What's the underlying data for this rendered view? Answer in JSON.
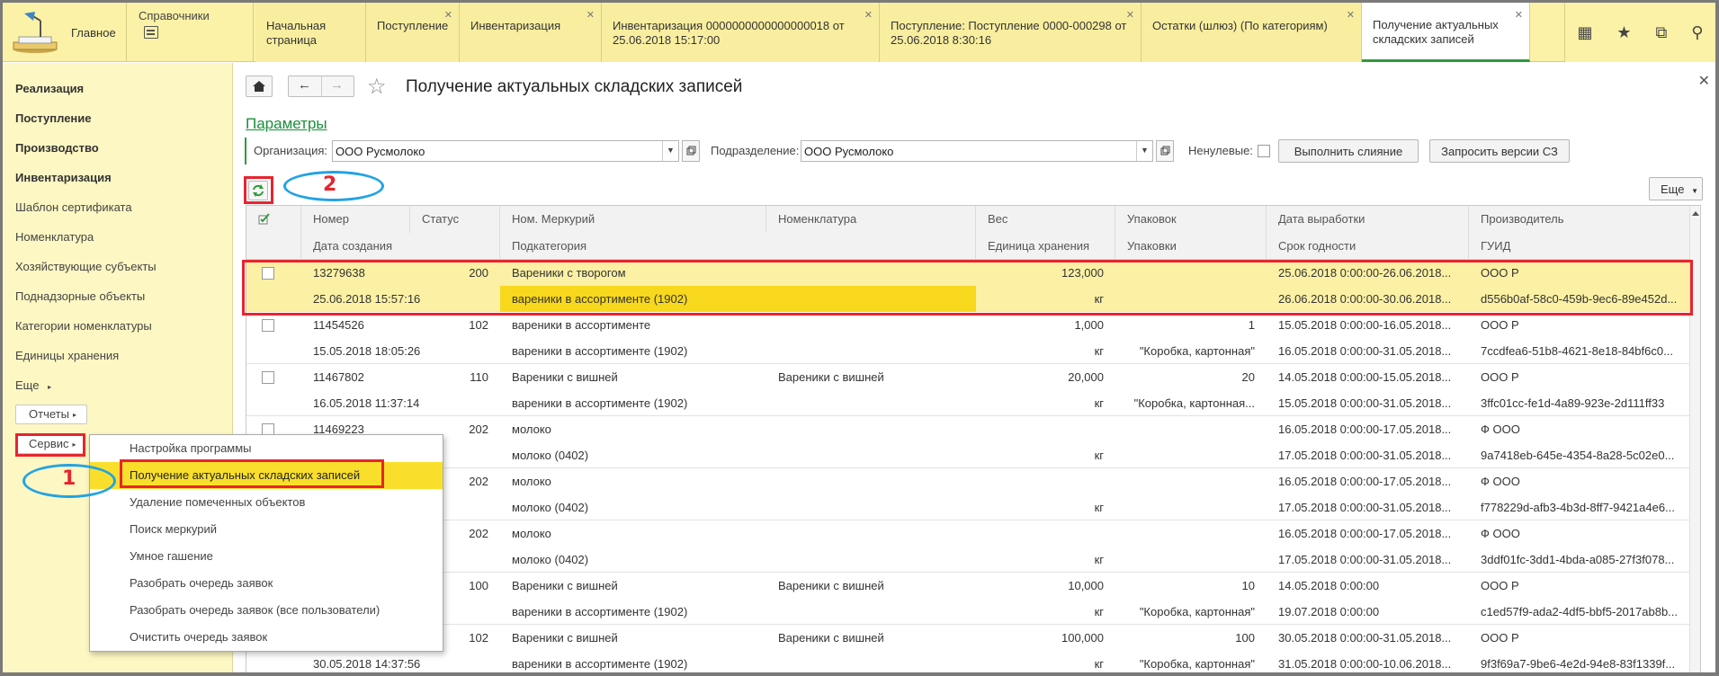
{
  "topbar": {
    "home_label": "Главное",
    "reference_label": "Справочники",
    "tabs": [
      {
        "label": "Начальная страница",
        "closable": false
      },
      {
        "label": "Поступление",
        "closable": true
      },
      {
        "label": "Инвентаризация",
        "closable": true
      },
      {
        "label": "Инвентаризация 0000000000000000018 от 25.06.2018 15:17:00",
        "closable": true
      },
      {
        "label": "Поступление: Поступление 0000-000298 от 25.06.2018 8:30:16",
        "closable": true
      },
      {
        "label": "Остатки (шлюз) (По категориям)",
        "closable": true
      },
      {
        "label": "Получение актуальных складских записей",
        "closable": true,
        "active": true
      }
    ],
    "right_icons": [
      "apps-icon",
      "star-icon",
      "history-icon",
      "search-icon"
    ]
  },
  "sidebar": {
    "sections": [
      "Реализация",
      "Поступление",
      "Производство",
      "Инвентаризация"
    ],
    "items": [
      "Шаблон сертификата",
      "Номенклатура",
      "Хозяйствующие субъекты",
      "Поднадзорные объекты",
      "Категории номенклатуры",
      "Единицы хранения"
    ],
    "more_label": "Еще",
    "reports_label": "Отчеты",
    "service_label": "Сервис"
  },
  "service_menu": {
    "items": [
      "Настройка программы",
      "Получение актуальных складских записей",
      "Удаление помеченных объектов",
      "Поиск меркурий",
      "Умное гашение",
      "Разобрать очередь заявок",
      "Разобрать очередь заявок (все пользователи)",
      "Очистить очередь заявок"
    ],
    "highlighted_index": 1
  },
  "page": {
    "title": "Получение актуальных складских записей",
    "params_link": "Параметры",
    "org_label": "Организация:",
    "org_value": "ООО Русмолоко",
    "dept_label": "Подразделение:",
    "dept_value": "ООО Русмолоко",
    "zero_label": "Ненулевые:",
    "merge_button": "Выполнить слияние",
    "request_button": "Запросить версии СЗ",
    "more_button": "Еще"
  },
  "grid": {
    "header_row1": [
      "Номер",
      "Статус",
      "Ном. Меркурий",
      "Номенклатура",
      "Вес",
      "Упаковок",
      "Дата выработки",
      "Производитель"
    ],
    "header_row2": [
      "Дата создания",
      "Подкатегория",
      "Единица хранения",
      "Упаковки",
      "Срок годности",
      "ГУИД"
    ],
    "rows": [
      {
        "number": "13279638",
        "status": "200",
        "merc": "Вареники с творогом",
        "nom": "",
        "weight": "123,000",
        "packs": "",
        "prod_date": "25.06.2018 0:00:00-26.06.2018...",
        "maker": "ООО Р",
        "created": "25.06.2018 15:57:16",
        "subcat": "вареники в ассортименте (1902)",
        "unit": "кг",
        "pack_type": "",
        "expiry": "26.06.2018 0:00:00-30.06.2018...",
        "guid": "d556b0af-58c0-459b-9ec6-89e452d...",
        "selected": true
      },
      {
        "number": "11454526",
        "status": "102",
        "merc": "вареники в ассортименте",
        "nom": "",
        "weight": "1,000",
        "packs": "1",
        "prod_date": "15.05.2018 0:00:00-16.05.2018...",
        "maker": "ООО Р",
        "created": "15.05.2018 18:05:26",
        "subcat": "вареники в ассортименте (1902)",
        "unit": "кг",
        "pack_type": "\"Коробка, картонная\"",
        "expiry": "16.05.2018 0:00:00-31.05.2018...",
        "guid": "7ccdfea6-51b8-4621-8e18-84bf6c0..."
      },
      {
        "number": "11467802",
        "status": "110",
        "merc": "Вареники с вишней",
        "nom": "Вареники с вишней",
        "weight": "20,000",
        "packs": "20",
        "prod_date": "14.05.2018 0:00:00-15.05.2018...",
        "maker": "ООО Р",
        "created": "16.05.2018 11:37:14",
        "subcat": "вареники в ассортименте (1902)",
        "unit": "кг",
        "pack_type": "\"Коробка, картонная...",
        "expiry": "15.05.2018 0:00:00-31.05.2018...",
        "guid": "3ffc01cc-fe1d-4a89-923e-2d111ff33"
      },
      {
        "number": "11469223",
        "status": "202",
        "merc": "молоко",
        "nom": "",
        "weight": "",
        "packs": "",
        "prod_date": "16.05.2018 0:00:00-17.05.2018...",
        "maker": "Ф          ООО",
        "created": "",
        "subcat": "молоко (0402)",
        "unit": "кг",
        "pack_type": "",
        "expiry": "17.05.2018 0:00:00-31.05.2018...",
        "guid": "9a7418eb-645e-4354-8a28-5c02e0..."
      },
      {
        "number": "",
        "status": "202",
        "merc": "молоко",
        "nom": "",
        "weight": "",
        "packs": "",
        "prod_date": "16.05.2018 0:00:00-17.05.2018...",
        "maker": "Ф          ООО",
        "created": "",
        "subcat": "молоко (0402)",
        "unit": "кг",
        "pack_type": "",
        "expiry": "17.05.2018 0:00:00-31.05.2018...",
        "guid": "f778229d-afb3-4b3d-8ff7-9421a4e6..."
      },
      {
        "number": "",
        "status": "202",
        "merc": "молоко",
        "nom": "",
        "weight": "",
        "packs": "",
        "prod_date": "16.05.2018 0:00:00-17.05.2018...",
        "maker": "Ф          ООО",
        "created": "",
        "subcat": "молоко (0402)",
        "unit": "кг",
        "pack_type": "",
        "expiry": "17.05.2018 0:00:00-31.05.2018...",
        "guid": "3ddf01fc-3dd1-4bda-a085-27f3f078..."
      },
      {
        "number": "",
        "status": "100",
        "merc": "Вареники с вишней",
        "nom": "Вареники с вишней",
        "weight": "10,000",
        "packs": "10",
        "prod_date": "14.05.2018 0:00:00",
        "maker": "ООО Р",
        "created": "",
        "subcat": "вареники в ассортименте (1902)",
        "unit": "кг",
        "pack_type": "\"Коробка, картонная\"",
        "expiry": "19.07.2018 0:00:00",
        "guid": "c1ed57f9-ada2-4df5-bbf5-2017ab8b..."
      },
      {
        "number": "",
        "status": "102",
        "merc": "Вареники с вишней",
        "nom": "Вареники с вишней",
        "weight": "100,000",
        "packs": "100",
        "prod_date": "30.05.2018 0:00:00-31.05.2018...",
        "maker": "ООО Р",
        "created": "30.05.2018 14:37:56",
        "subcat": "вареники в ассортименте (1902)",
        "unit": "кг",
        "pack_type": "\"Коробка, картонная\"",
        "expiry": "31.05.2018 0:00:00-10.06.2018...",
        "guid": "9f3f69a7-9be6-4e2d-94e8-83f1339f..."
      }
    ]
  },
  "annotations": {
    "label_1": "1",
    "label_2": "2",
    "rect_color": "#e8242f",
    "ellipse_color": "#21a3e3"
  },
  "colors": {
    "topbar_bg": "#fbf2a7",
    "sidebar_bg": "#fdf7c3",
    "selected_row_bg": "#fbf0a4",
    "highlight": "#f7d81c",
    "accent_green": "#1a8f3a"
  }
}
